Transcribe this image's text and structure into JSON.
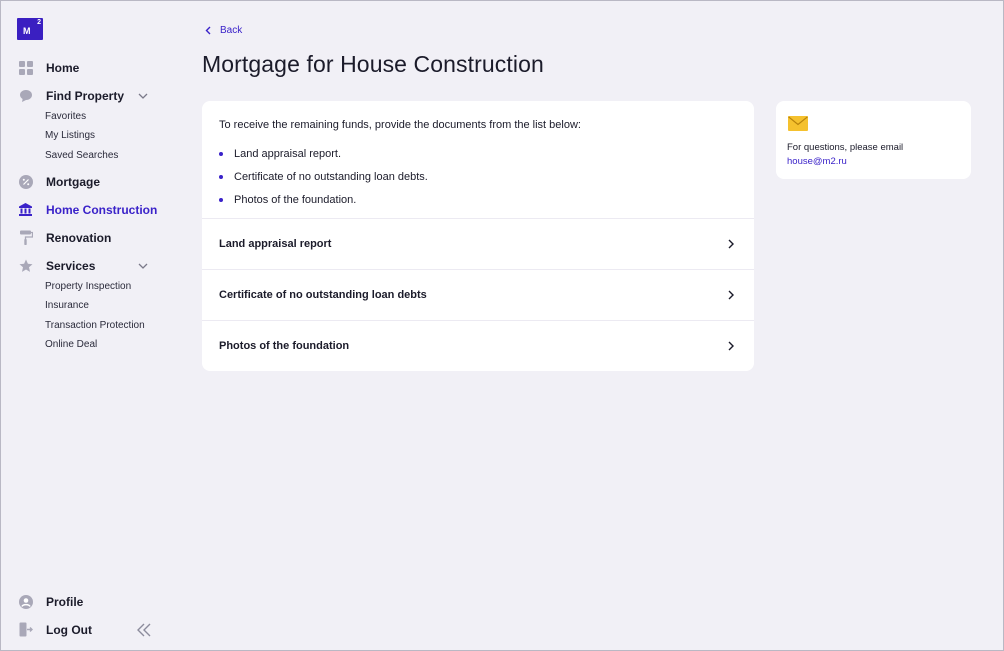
{
  "logo": {
    "main": "M",
    "sup": "2"
  },
  "sidebar": {
    "nav": [
      {
        "label": "Home",
        "icon": "grid-icon"
      },
      {
        "label": "Find Property",
        "icon": "chat-bubble-icon"
      },
      {
        "label": "Mortgage",
        "icon": "percent-icon"
      },
      {
        "label": "Home Construction",
        "icon": "bank-icon"
      },
      {
        "label": "Renovation",
        "icon": "paint-roller-icon"
      },
      {
        "label": "Services",
        "icon": "star-icon"
      }
    ],
    "find_property_sub": [
      "Favorites",
      "My Listings",
      "Saved Searches"
    ],
    "services_sub": [
      "Property Inspection",
      "Insurance",
      "Transaction Protection",
      "Online Deal"
    ],
    "profile": "Profile",
    "logout": "Log Out"
  },
  "main": {
    "back": "Back",
    "title": "Mortgage for House Construction",
    "intro": "To receive the remaining funds, provide the documents from the list below:",
    "bullets": [
      "Land appraisal report.",
      "Certificate of no outstanding loan debts.",
      "Photos of the foundation."
    ],
    "documents": [
      "Land appraisal report",
      "Certificate of no outstanding loan debts",
      "Photos of the foundation"
    ]
  },
  "contact": {
    "text": "For questions, please email",
    "email": "house@m2.ru"
  },
  "colors": {
    "accent": "#3a22c9",
    "icon_gray": "#a9a8b8",
    "mail_yellow": "#f5c12e",
    "background": "#f1f0f6"
  }
}
